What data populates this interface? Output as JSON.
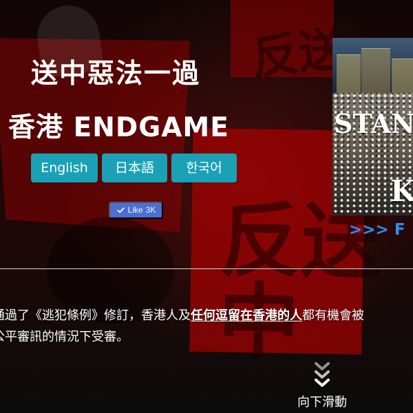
{
  "hero": {
    "title_line_1": "送中惡法一過",
    "title_line_2": "香港 ENDGAME"
  },
  "languages": [
    {
      "label": "English"
    },
    {
      "label": "日本語"
    },
    {
      "label": "한국어"
    }
  ],
  "like_button": {
    "label": "Like",
    "count": "3K"
  },
  "video_preview": {
    "visible_text_1": "STAN",
    "visible_text_2": "K",
    "link_text": ">>> F"
  },
  "description": {
    "line_1_before": "通過了《逃犯條例》修訂，香港人及",
    "line_1_highlight": "任何逗留在香港的人",
    "line_1_after": "都有機會被",
    "line_2": "公平審訊的情況下受審。"
  },
  "scroll": {
    "label": "向下滑動"
  },
  "background_text": {
    "top_sign": "反送",
    "middle_sign": "反送中"
  },
  "colors": {
    "button_accent": "#1aa1b6",
    "like_blue": "#4b6fd1",
    "video_link_blue": "#2d8df0",
    "background_red": "#aa0000",
    "text_white": "#ffffff"
  },
  "icons": {
    "like": "check-icon",
    "scroll": "double-chevron-down-icon"
  }
}
